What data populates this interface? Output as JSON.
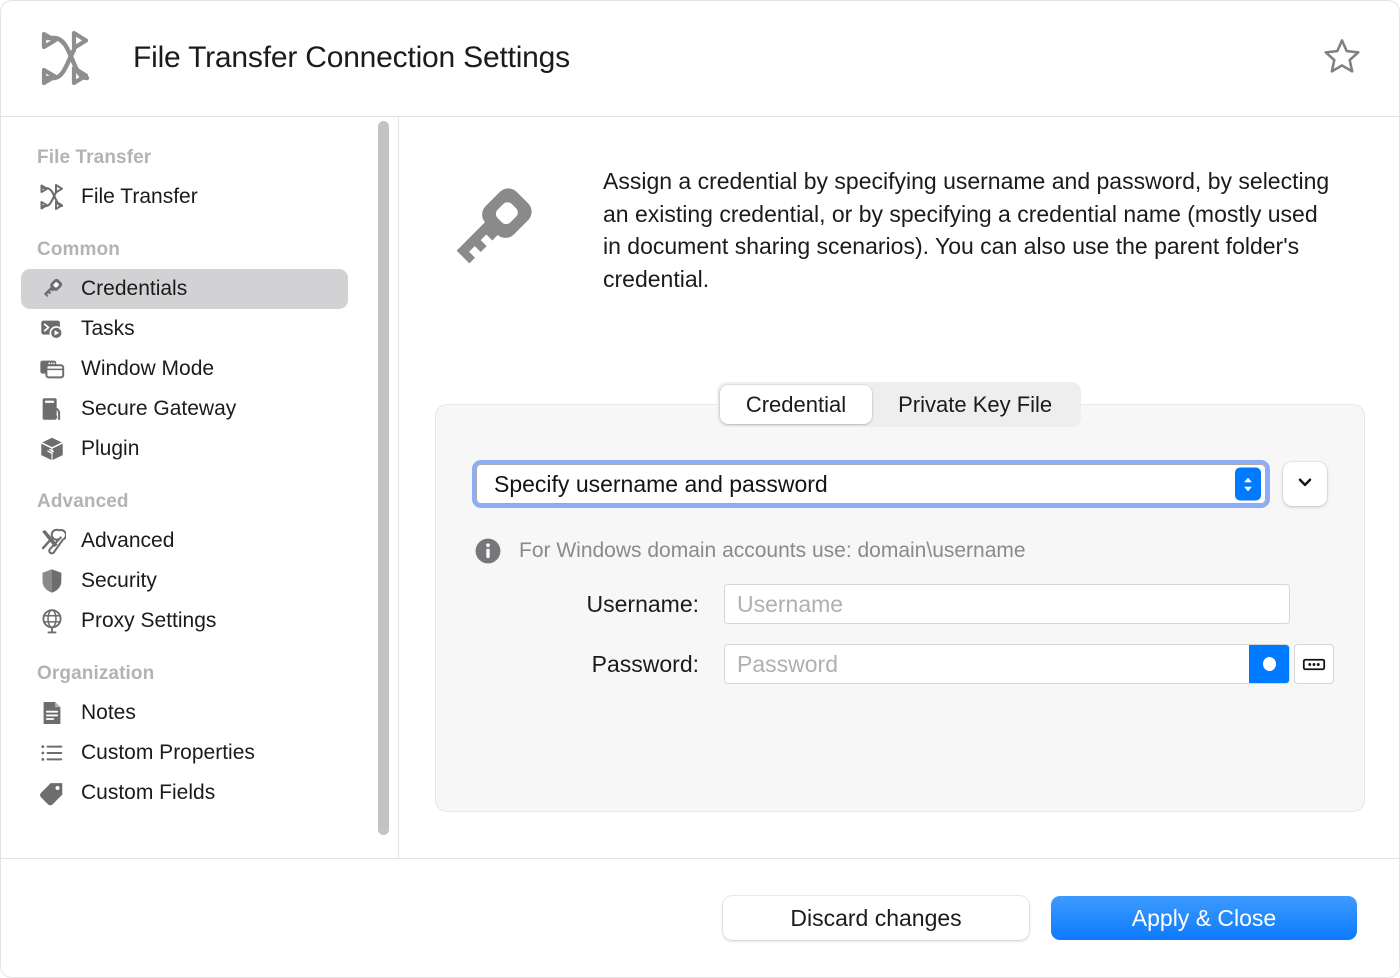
{
  "window": {
    "title": "File Transfer Connection Settings",
    "app_icon": "file-transfer-icon",
    "favorite_icon": "star-outline-icon"
  },
  "sidebar": {
    "groups": [
      {
        "label": "File Transfer",
        "items": [
          {
            "label": "File Transfer",
            "icon": "file-transfer-icon",
            "selected": false
          }
        ]
      },
      {
        "label": "Common",
        "items": [
          {
            "label": "Credentials",
            "icon": "key-icon",
            "selected": true
          },
          {
            "label": "Tasks",
            "icon": "tasks-icon",
            "selected": false
          },
          {
            "label": "Window Mode",
            "icon": "window-mode-icon",
            "selected": false
          },
          {
            "label": "Secure Gateway",
            "icon": "secure-gateway-icon",
            "selected": false
          },
          {
            "label": "Plugin",
            "icon": "plugin-cube-icon",
            "selected": false
          }
        ]
      },
      {
        "label": "Advanced",
        "items": [
          {
            "label": "Advanced",
            "icon": "tools-icon",
            "selected": false
          },
          {
            "label": "Security",
            "icon": "shield-icon",
            "selected": false
          },
          {
            "label": "Proxy Settings",
            "icon": "globe-icon",
            "selected": false
          }
        ]
      },
      {
        "label": "Organization",
        "items": [
          {
            "label": "Notes",
            "icon": "note-document-icon",
            "selected": false
          },
          {
            "label": "Custom Properties",
            "icon": "list-icon",
            "selected": false
          },
          {
            "label": "Custom Fields",
            "icon": "tag-icon",
            "selected": false
          }
        ]
      }
    ]
  },
  "content": {
    "intro_icon": "key-icon",
    "intro_text": "Assign a credential by specifying username and password, by selecting an existing credential, or by specifying a credential name (mostly used in document sharing scenarios). You can also use the parent folder's credential.",
    "tabs": [
      {
        "label": "Credential",
        "active": true
      },
      {
        "label": "Private Key File",
        "active": false
      }
    ],
    "credential_mode": {
      "selected": "Specify username and password",
      "stepper_icon": "chevron-up-down-icon",
      "extra_button_icon": "chevron-down-icon"
    },
    "hint": {
      "icon": "info-icon",
      "text": "For Windows domain accounts use: domain\\username"
    },
    "fields": [
      {
        "label": "Username:",
        "placeholder": "Username",
        "value": ""
      },
      {
        "label": "Password:",
        "placeholder": "Password",
        "value": ""
      }
    ],
    "password_reveal_icon": "reveal-dot-icon",
    "password_keyboard_icon": "password-dots-icon"
  },
  "footer": {
    "discard_label": "Discard changes",
    "apply_label": "Apply & Close"
  },
  "colors": {
    "accent": "#007aff",
    "apply_button": "#0d7afc",
    "focus_ring": "#8eadf7",
    "selected_row": "#d2d2d4",
    "card_bg": "#f7f7f7",
    "muted_text": "#8a8a8e",
    "group_label": "#b3b3b5"
  }
}
